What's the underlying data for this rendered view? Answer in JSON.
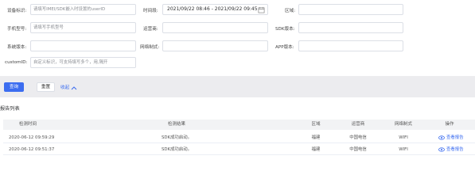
{
  "filters": {
    "device_id": {
      "label": "设备标识:",
      "placeholder": "请填写IMEI/SDK嵌入时设置的userID"
    },
    "time_range": {
      "label": "时间段:",
      "value": "2021/09/22 08:46 - 2021/09/22 09:45",
      "icon": "calendar-icon"
    },
    "region": {
      "label": "区域:",
      "value": ""
    },
    "phone": {
      "label": "手机型号:",
      "placeholder": "请填写手机型号"
    },
    "carrier": {
      "label": "运营商:",
      "value": ""
    },
    "sdk_version": {
      "label": "SDK版本:",
      "value": ""
    },
    "os_version": {
      "label": "系统版本:",
      "value": ""
    },
    "network": {
      "label": "网络制式:",
      "value": ""
    },
    "app_version": {
      "label": "APP版本:",
      "value": ""
    },
    "custom_id": {
      "label": "customID:",
      "placeholder": "自定义标识，可支持填写多个，用,隔开"
    }
  },
  "actions": {
    "query": "查询",
    "reset": "重置",
    "collapse": "收起",
    "colors": {
      "primary": "#3c6df0",
      "bar_bg": "#ececef"
    }
  },
  "report": {
    "title": "报告列表",
    "columns": [
      "检测时间",
      "检测结果",
      "区域",
      "运营商",
      "网络制式",
      "操作"
    ],
    "rows": [
      {
        "time": "2020-06-12 09:59:29",
        "result": "SDK成功启动。",
        "region": "福建",
        "carrier": "中国电信",
        "network": "WIFI",
        "action": "查看报告"
      },
      {
        "time": "2020-06-12 09:51:37",
        "result": "SDK成功启动。",
        "region": "福建",
        "carrier": "中国电信",
        "network": "WIFI",
        "action": "查看报告"
      }
    ]
  }
}
